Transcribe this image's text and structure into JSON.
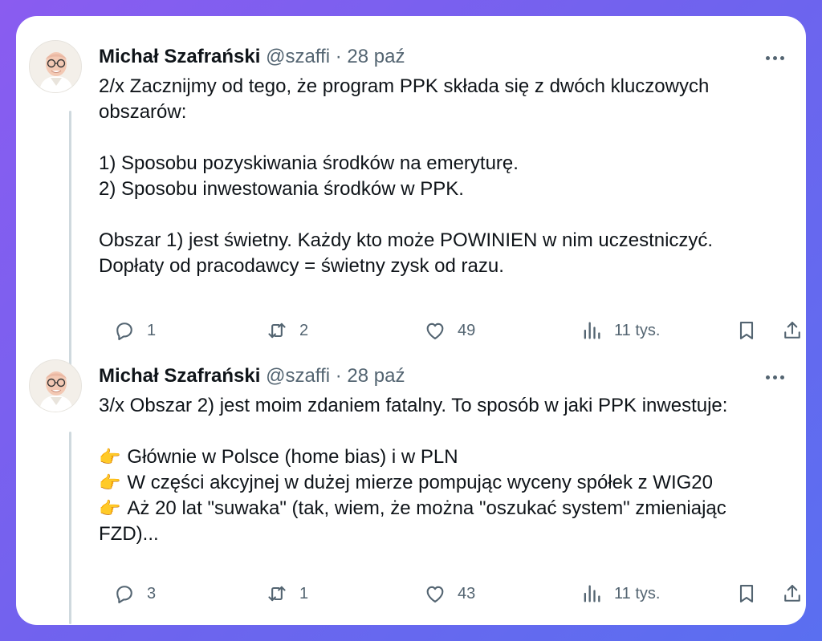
{
  "tweets": [
    {
      "author_name": "Michał Szafrański",
      "handle": "@szaffi",
      "separator": "·",
      "date": "28 paź",
      "lines": [
        "2/x Zacznijmy od tego, że program PPK składa się z dwóch kluczowych",
        "obszarów:",
        "",
        "1) Sposobu pozyskiwania środków na emeryturę.",
        "2) Sposobu inwestowania środków w PPK.",
        "",
        "Obszar 1) jest świetny. Każdy kto może POWINIEN w nim uczestniczyć.",
        "Dopłaty od pracodawcy = świetny zysk od razu."
      ],
      "replies": "1",
      "retweets": "2",
      "likes": "49",
      "views": "11 tys."
    },
    {
      "author_name": "Michał Szafrański",
      "handle": "@szaffi",
      "separator": "·",
      "date": "28 paź",
      "lines": [
        "3/x Obszar 2) jest moim zdaniem fatalny. To sposób w jaki PPK inwestuje:",
        "",
        "Głównie w Polsce (home bias) i w PLN",
        "W części akcyjnej w dużej mierze pompując wyceny spółek z WIG20",
        "Aż 20 lat \"suwaka\" (tak, wiem, że można \"oszukać system\" zmieniając",
        "FZD)..."
      ],
      "bullet_emoji": "👉",
      "replies": "3",
      "retweets": "1",
      "likes": "43",
      "views": "11 tys."
    }
  ],
  "icons": {
    "reply": "reply-icon",
    "retweet": "retweet-icon",
    "like": "heart-icon",
    "views": "views-icon",
    "bookmark": "bookmark-icon",
    "share": "share-icon",
    "more": "more-icon"
  },
  "colors": {
    "text": "#0f1419",
    "secondary": "#536471",
    "thread_line": "#cfd9de",
    "background_gradient_start": "#8a5cf0",
    "background_gradient_end": "#5a6ff0"
  }
}
